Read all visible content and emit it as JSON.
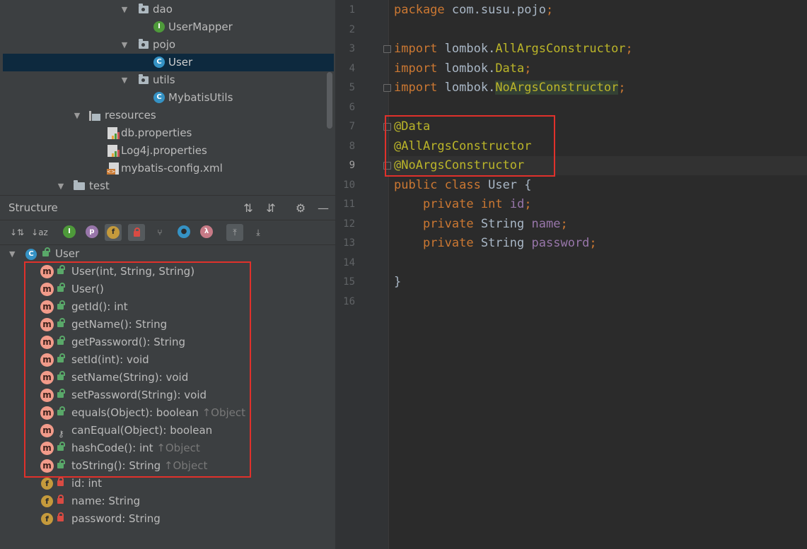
{
  "project_tree": {
    "items": [
      {
        "label": "dao",
        "type": "package",
        "expanded": true
      },
      {
        "label": "UserMapper",
        "type": "interface"
      },
      {
        "label": "pojo",
        "type": "package",
        "expanded": true
      },
      {
        "label": "User",
        "type": "class",
        "selected": true
      },
      {
        "label": "utils",
        "type": "package",
        "expanded": true
      },
      {
        "label": "MybatisUtils",
        "type": "class"
      },
      {
        "label": "resources",
        "type": "resources-folder",
        "expanded": true
      },
      {
        "label": "db.properties",
        "type": "properties-file"
      },
      {
        "label": "Log4j.properties",
        "type": "properties-file"
      },
      {
        "label": "mybatis-config.xml",
        "type": "xml-file"
      },
      {
        "label": "test",
        "type": "folder",
        "expanded": true
      }
    ],
    "icons": {
      "interface_letter": "I",
      "class_letter": "C"
    }
  },
  "structure": {
    "title": "Structure",
    "root": {
      "label": "User",
      "icon_letter": "C"
    },
    "toolbar": {
      "inherited_letter": "I",
      "property_letter": "p",
      "field_letter": "f",
      "lambda_letter": "λ"
    },
    "members": [
      {
        "label": "User(int, String, String)",
        "kind": "method",
        "access": "public"
      },
      {
        "label": "User()",
        "kind": "method",
        "access": "public"
      },
      {
        "label": "getId(): int",
        "kind": "method",
        "access": "public"
      },
      {
        "label": "getName(): String",
        "kind": "method",
        "access": "public"
      },
      {
        "label": "getPassword(): String",
        "kind": "method",
        "access": "public"
      },
      {
        "label": "setId(int): void",
        "kind": "method",
        "access": "public"
      },
      {
        "label": "setName(String): void",
        "kind": "method",
        "access": "public"
      },
      {
        "label": "setPassword(String): void",
        "kind": "method",
        "access": "public"
      },
      {
        "label": "equals(Object): boolean",
        "kind": "method",
        "access": "public",
        "inherited": "↑Object"
      },
      {
        "label": "canEqual(Object): boolean",
        "kind": "method",
        "access": "protected"
      },
      {
        "label": "hashCode(): int",
        "kind": "method",
        "access": "public",
        "inherited": "↑Object"
      },
      {
        "label": "toString(): String",
        "kind": "method",
        "access": "public",
        "inherited": "↑Object"
      },
      {
        "label": "id: int",
        "kind": "field",
        "access": "private"
      },
      {
        "label": "name: String",
        "kind": "field",
        "access": "private"
      },
      {
        "label": "password: String",
        "kind": "field",
        "access": "private"
      }
    ],
    "method_letter": "m",
    "field_letter": "f"
  },
  "editor": {
    "current_line": "9",
    "line_numbers": [
      "1",
      "2",
      "3",
      "4",
      "5",
      "6",
      "7",
      "8",
      "9",
      "10",
      "11",
      "12",
      "13",
      "14",
      "15",
      "16"
    ],
    "code": {
      "l1_kw": "package",
      "l1_rest": " com.susu.pojo",
      "import_kw": "import",
      "lombok": " lombok.",
      "l3_cls": "AllArgsConstructor",
      "l4_cls": "Data",
      "l5_cls": "NoArgsConstructor",
      "semi": ";",
      "a1": "@Data",
      "a2": "@AllArgsConstructor",
      "a3": "@NoArgsConstructor",
      "public_kw": "public",
      "class_kw": "class",
      "class_name": " User {",
      "private_kw": "private",
      "int_kw": "int",
      "string_ty": "String",
      "f_id": "id",
      "f_name": "name",
      "f_password": "password",
      "close": "}"
    }
  },
  "colors": {
    "highlight_box": "#e0312b",
    "keyword": "#cc7832",
    "annotation": "#bbb529",
    "field": "#9876aa",
    "method_icon": "#f29b8a",
    "field_icon": "#c49a3c",
    "public_lock": "#59a869",
    "private_lock": "#d94b43"
  }
}
